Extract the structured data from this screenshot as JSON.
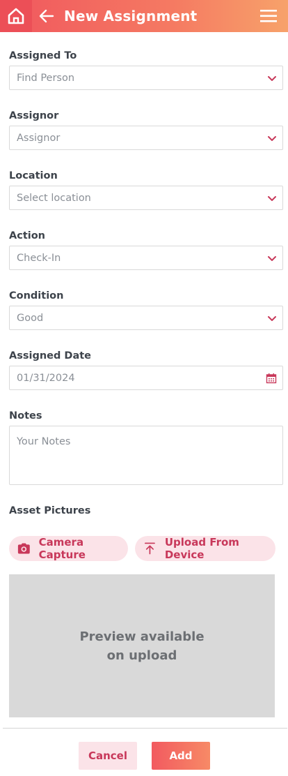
{
  "header": {
    "title": "New Assignment",
    "home_icon": "home-icon",
    "back_icon": "arrow-left-icon",
    "menu_icon": "hamburger-menu-icon",
    "accent_color": "#f0575e"
  },
  "form": {
    "assigned_to": {
      "label": "Assigned To",
      "value": "Find Person"
    },
    "assignor": {
      "label": "Assignor",
      "value": "Assignor"
    },
    "location": {
      "label": "Location",
      "value": "Select location"
    },
    "action": {
      "label": "Action",
      "value": "Check-In"
    },
    "condition": {
      "label": "Condition",
      "value": "Good"
    },
    "assigned_date": {
      "label": "Assigned Date",
      "value": "01/31/2024"
    },
    "notes": {
      "label": "Notes",
      "placeholder": "Your Notes"
    },
    "asset_pictures": {
      "label": "Asset Pictures",
      "camera_label": "Camera Capture",
      "upload_label": "Upload From Device",
      "preview_text": "Preview available on upload"
    }
  },
  "footer": {
    "cancel_label": "Cancel",
    "add_label": "Add"
  }
}
